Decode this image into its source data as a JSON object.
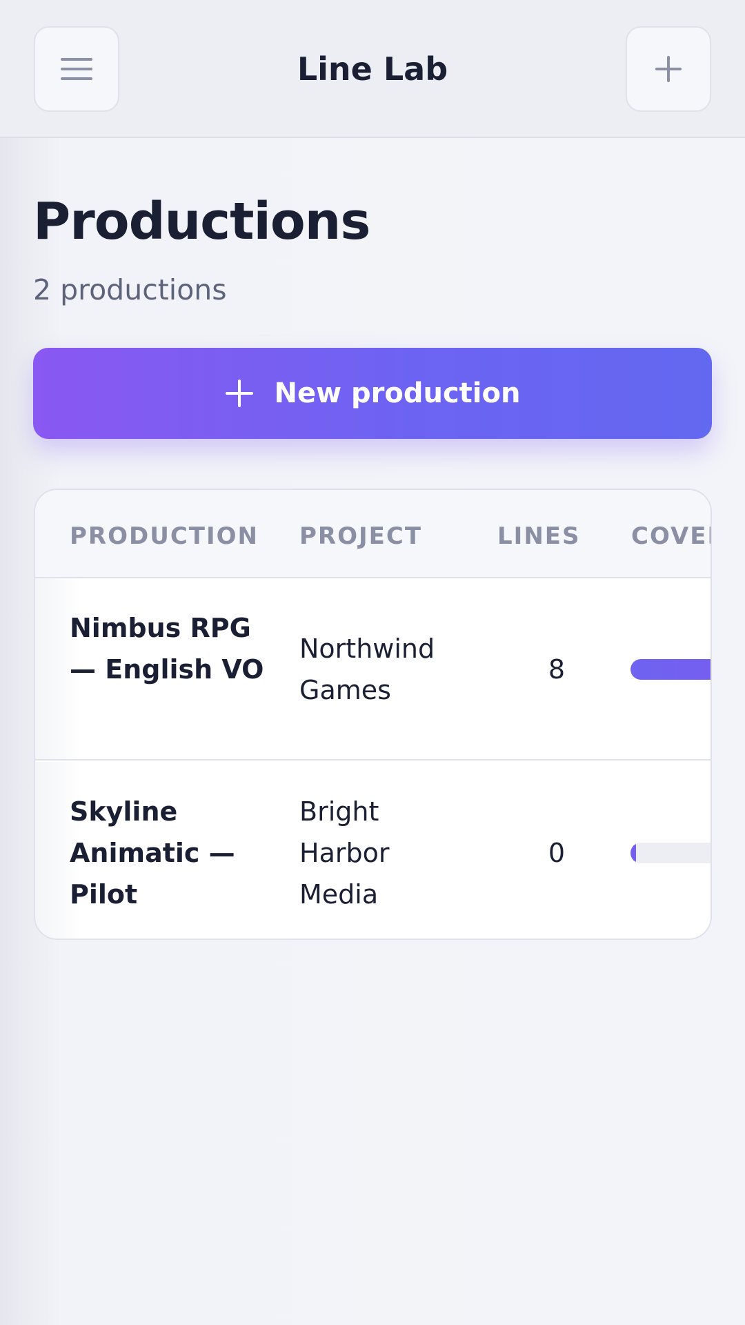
{
  "header": {
    "app_title": "Line Lab",
    "menu_icon": "menu-icon",
    "add_icon": "plus-icon"
  },
  "main": {
    "title": "Productions",
    "subtitle": "2 productions",
    "new_button_label": "New production",
    "new_button_icon": "plus-icon"
  },
  "table": {
    "columns": [
      "PRODUCTION",
      "PROJECT",
      "LINES",
      "COVER"
    ],
    "rows": [
      {
        "production": "Nimbus RPG — English VO",
        "project": "Northwind Games",
        "lines": "8",
        "coverage": 1.0
      },
      {
        "production": "Skyline Animatic — Pilot",
        "project": "Bright Harbor Media",
        "lines": "0",
        "coverage": 0.0
      }
    ]
  },
  "colors": {
    "accent_start": "#8a58f2",
    "accent_end": "#6368f1",
    "text_primary": "#1a1f33",
    "text_muted": "#8a8fa4"
  }
}
